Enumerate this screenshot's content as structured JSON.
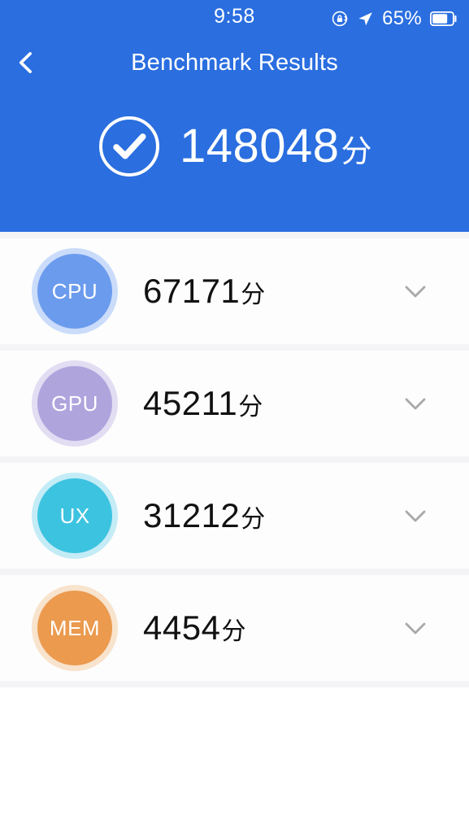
{
  "status_bar": {
    "time": "9:58",
    "battery_percent": "65%",
    "icons": [
      "rotation-lock-icon",
      "location-arrow-icon",
      "battery-icon"
    ]
  },
  "header": {
    "back_icon": "chevron-left-icon",
    "title": "Benchmark Results",
    "total_icon": "check-circle-icon",
    "total_score": "148048",
    "total_unit": "分",
    "background_color": "#2a6ee0"
  },
  "results": [
    {
      "key": "cpu",
      "label": "CPU",
      "score": "67171",
      "unit": "分",
      "color": "#6b9bed",
      "ring_color": "#cadcfa",
      "expand_icon": "chevron-down-icon"
    },
    {
      "key": "gpu",
      "label": "GPU",
      "score": "45211",
      "unit": "分",
      "color": "#b0a4dd",
      "ring_color": "#e2ddf2",
      "expand_icon": "chevron-down-icon"
    },
    {
      "key": "ux",
      "label": "UX",
      "score": "31212",
      "unit": "分",
      "color": "#3cc3e0",
      "ring_color": "#c4ecf6",
      "expand_icon": "chevron-down-icon"
    },
    {
      "key": "mem",
      "label": "MEM",
      "score": "4454",
      "unit": "分",
      "color": "#eb9a4e",
      "ring_color": "#f8e3cd",
      "expand_icon": "chevron-down-icon"
    }
  ]
}
